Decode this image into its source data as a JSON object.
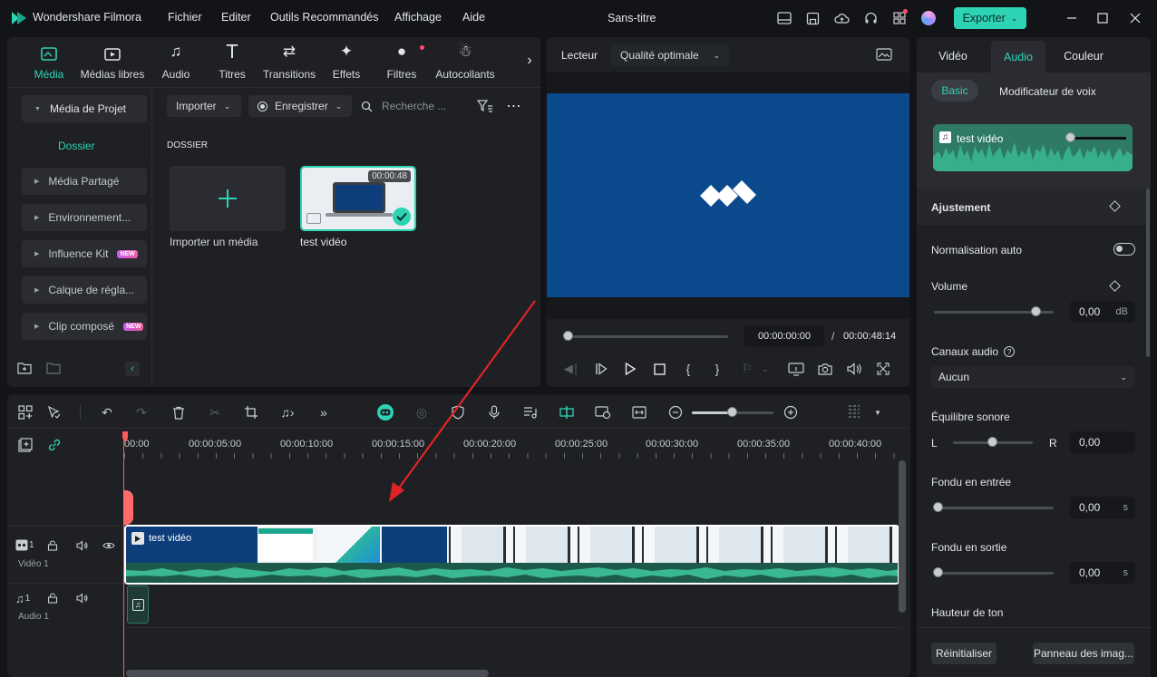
{
  "app": {
    "name": "Wondershare Filmora",
    "menu": [
      "Fichier",
      "Editer",
      "Outils Recommandés",
      "Affichage",
      "Aide"
    ],
    "project_title": "Sans-titre",
    "export_label": "Exporter"
  },
  "media_toolbar": {
    "tabs": [
      {
        "label": "Média",
        "icon": "media-icon"
      },
      {
        "label": "Médias libres",
        "icon": "stock-media-icon"
      },
      {
        "label": "Audio",
        "icon": "music-icon"
      },
      {
        "label": "Titres",
        "icon": "title-icon"
      },
      {
        "label": "Transitions",
        "icon": "transitions-icon"
      },
      {
        "label": "Effets",
        "icon": "effects-icon"
      },
      {
        "label": "Filtres",
        "icon": "filters-icon"
      },
      {
        "label": "Autocollants",
        "icon": "stickers-icon"
      }
    ]
  },
  "sidebar": {
    "project_media": "Média de Projet",
    "folder": "Dossier",
    "items": [
      {
        "label": "Média Partagé",
        "badge": ""
      },
      {
        "label": "Environnement...",
        "badge": ""
      },
      {
        "label": "Influence Kit",
        "badge": "NEW"
      },
      {
        "label": "Calque de régla...",
        "badge": ""
      },
      {
        "label": "Clip composé",
        "badge": "NEW"
      }
    ]
  },
  "media_panel": {
    "import_label": "Importer",
    "record_label": "Enregistrer",
    "search_placeholder": "Recherche ...",
    "section_title": "DOSSIER",
    "import_tile_label": "Importer un média",
    "clip_name": "test vidéo",
    "clip_duration": "00:00:48"
  },
  "player": {
    "label": "Lecteur",
    "quality": "Qualité optimale",
    "current_time": "00:00:00:00",
    "separator": "/",
    "total_time": "00:00:48:14"
  },
  "right_panel": {
    "tabs": [
      "Vidéo",
      "Audio",
      "Couleur"
    ],
    "subtabs": [
      "Basic",
      "Modificateur de voix"
    ],
    "clip_name": "test vidéo",
    "section": "Ajustement",
    "auto_normalization": "Normalisation auto",
    "volume_label": "Volume",
    "volume_value": "0,00",
    "volume_unit": "dB",
    "channels_label": "Canaux audio",
    "channels_value": "Aucun",
    "balance_label": "Équilibre sonore",
    "balance_left": "L",
    "balance_right": "R",
    "balance_value": "0,00",
    "fade_in_label": "Fondu en entrée",
    "fade_in_value": "0,00",
    "fade_out_label": "Fondu en sortie",
    "fade_out_value": "0,00",
    "seconds_unit": "s",
    "pitch_label": "Hauteur de ton",
    "reset_label": "Réinitialiser",
    "panel_label": "Panneau des imag..."
  },
  "timeline": {
    "ruler": [
      "00:00",
      "00:00:05:00",
      "00:00:10:00",
      "00:00:15:00",
      "00:00:20:00",
      "00:00:25:00",
      "00:00:30:00",
      "00:00:35:00",
      "00:00:40:00"
    ],
    "video_track_num": "1",
    "video_track_label": "Vidéo 1",
    "audio_track_num": "1",
    "audio_track_label": "Audio 1",
    "clip_label": "test vidéo"
  },
  "colors": {
    "accent": "#2ed3b3",
    "playhead": "#ff5a5a",
    "preview_bg": "#0a4a8c",
    "arrow": "#e02424"
  }
}
